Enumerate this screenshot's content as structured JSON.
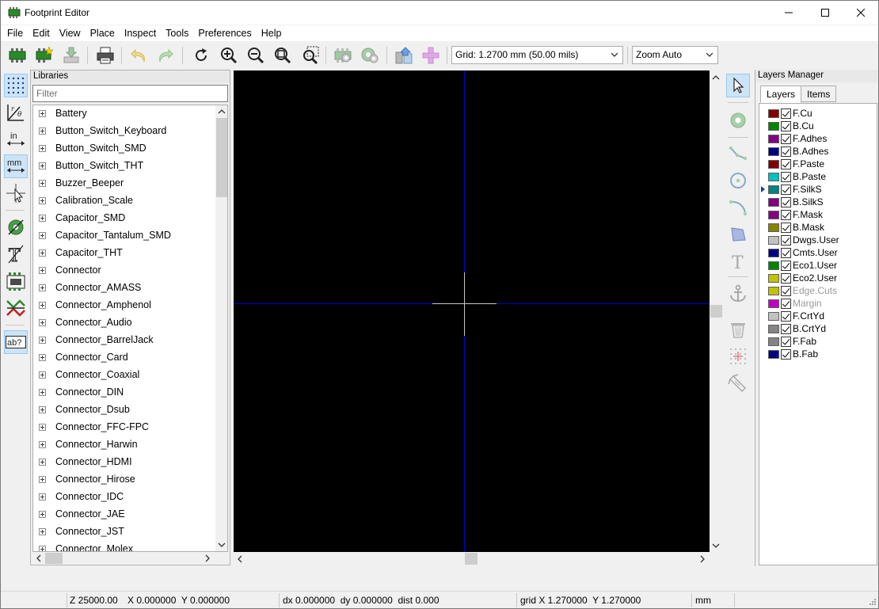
{
  "window": {
    "title": "Footprint Editor",
    "controls": [
      "minimize",
      "maximize",
      "close"
    ]
  },
  "menubar": [
    "File",
    "Edit",
    "View",
    "Place",
    "Inspect",
    "Tools",
    "Preferences",
    "Help"
  ],
  "toolbar": {
    "grid_combo": "Grid: 1.2700 mm (50.00 mils)",
    "zoom_combo": "Zoom Auto"
  },
  "libraries": {
    "title": "Libraries",
    "filter_placeholder": "Filter",
    "items": [
      "Battery",
      "Button_Switch_Keyboard",
      "Button_Switch_SMD",
      "Button_Switch_THT",
      "Buzzer_Beeper",
      "Calibration_Scale",
      "Capacitor_SMD",
      "Capacitor_Tantalum_SMD",
      "Capacitor_THT",
      "Connector",
      "Connector_AMASS",
      "Connector_Amphenol",
      "Connector_Audio",
      "Connector_BarrelJack",
      "Connector_Card",
      "Connector_Coaxial",
      "Connector_DIN",
      "Connector_Dsub",
      "Connector_FFC-FPC",
      "Connector_Harwin",
      "Connector_HDMI",
      "Connector_Hirose",
      "Connector_IDC",
      "Connector_JAE",
      "Connector_JST",
      "Connector_Molex"
    ]
  },
  "layers_manager": {
    "title": "Layers Manager",
    "tabs": [
      "Layers",
      "Items"
    ],
    "active_tab": "Layers",
    "layers": [
      {
        "name": "F.Cu",
        "color": "#840000",
        "checked": true
      },
      {
        "name": "B.Cu",
        "color": "#008400",
        "checked": true
      },
      {
        "name": "F.Adhes",
        "color": "#840084",
        "checked": true
      },
      {
        "name": "B.Adhes",
        "color": "#000084",
        "checked": true
      },
      {
        "name": "F.Paste",
        "color": "#840000",
        "checked": true
      },
      {
        "name": "B.Paste",
        "color": "#00c2c2",
        "checked": true
      },
      {
        "name": "F.SilkS",
        "color": "#008484",
        "checked": true,
        "selected": true
      },
      {
        "name": "B.SilkS",
        "color": "#840084",
        "checked": true
      },
      {
        "name": "F.Mask",
        "color": "#840084",
        "checked": true
      },
      {
        "name": "B.Mask",
        "color": "#848400",
        "checked": true
      },
      {
        "name": "Dwgs.User",
        "color": "#c2c2c2",
        "checked": true
      },
      {
        "name": "Cmts.User",
        "color": "#000084",
        "checked": true
      },
      {
        "name": "Eco1.User",
        "color": "#008400",
        "checked": true
      },
      {
        "name": "Eco2.User",
        "color": "#c2c200",
        "checked": true
      },
      {
        "name": "Edge.Cuts",
        "color": "#c2c200",
        "checked": true,
        "dim": true
      },
      {
        "name": "Margin",
        "color": "#c200c2",
        "checked": true,
        "dim": true
      },
      {
        "name": "F.CrtYd",
        "color": "#c2c2c2",
        "checked": true
      },
      {
        "name": "B.CrtYd",
        "color": "#848484",
        "checked": true
      },
      {
        "name": "F.Fab",
        "color": "#848484",
        "checked": true
      },
      {
        "name": "B.Fab",
        "color": "#000084",
        "checked": true
      }
    ]
  },
  "statusbar": {
    "zoom": "Z 25000.00",
    "cursor": "X 0.000000  Y 0.000000",
    "delta": "dx 0.000000  dy 0.000000  dist 0.000",
    "grid": "grid X 1.270000  Y 1.270000",
    "units": "mm"
  },
  "colors": {
    "canvas_bg": "#000000",
    "axis": "#0000c8",
    "cursor": "#c8c8c8",
    "accent_active": "#cce4f7"
  }
}
